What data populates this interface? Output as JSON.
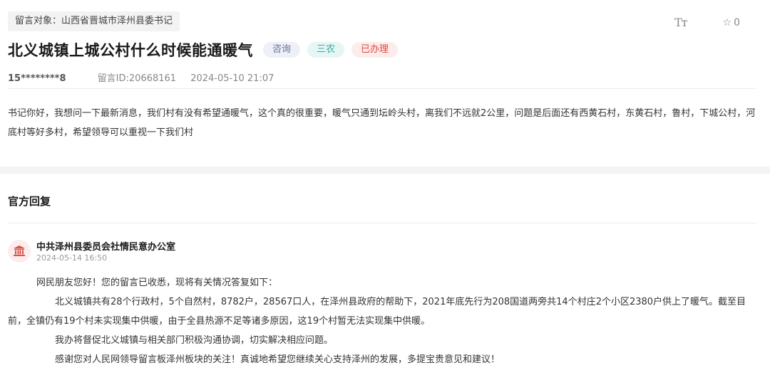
{
  "header": {
    "target_label": "留言对象：山西省晋城市泽州县委书记",
    "font_toggle_label": "Tт",
    "favorite_icon": "star-outline-icon",
    "favorite_count": "0"
  },
  "message": {
    "title": "北义城镇上城公村什么时候能通暖气",
    "tags": [
      "咨询",
      "三农",
      "已办理"
    ],
    "user": "15********8",
    "message_id": "留言ID:20668161",
    "time": "2024-05-10 21:07",
    "content": "书记你好，我想问一下最新消息，我们村有没有希望通暖气，这个真的很重要，暖气只通到坛岭头村，离我们不远就2公里，问题是后面还有西黄石村，东黄石村，鲁村，下城公村，河底村等好多村，希望领导可以重视一下我们村"
  },
  "reply": {
    "section_title": "官方回复",
    "avatar_icon": "government-building-icon",
    "office": "中共泽州县委员会社情民意办公室",
    "time": "2024-05-14 16:50",
    "paragraphs": [
      "网民朋友您好！您的留言已收悉，现将有关情况答复如下：",
      "北义城镇共有28个行政村，5个自然村，8782户，28567口人，在泽州县政府的帮助下，2021年底先行为208国道两旁共14个村庄2个小区2380户供上了暖气。截至目前，全镇仍有19个村未实现集中供暖，由于全县热源不足等诸多原因，这19个村暂无法实现集中供暖。",
      "我办将督促北义城镇与相关部门积极沟通协调，切实解决相应问题。",
      "感谢您对人民网领导留言板泽州板块的关注！真诚地希望您继续关心支持泽州的发展，多提宝贵意见和建议！"
    ]
  },
  "colors": {
    "tag_consult_text": "#6a7398",
    "tag_sannong_text": "#3aa79e",
    "tag_done_text": "#e0473f",
    "avatar_icon": "#d9534f"
  }
}
